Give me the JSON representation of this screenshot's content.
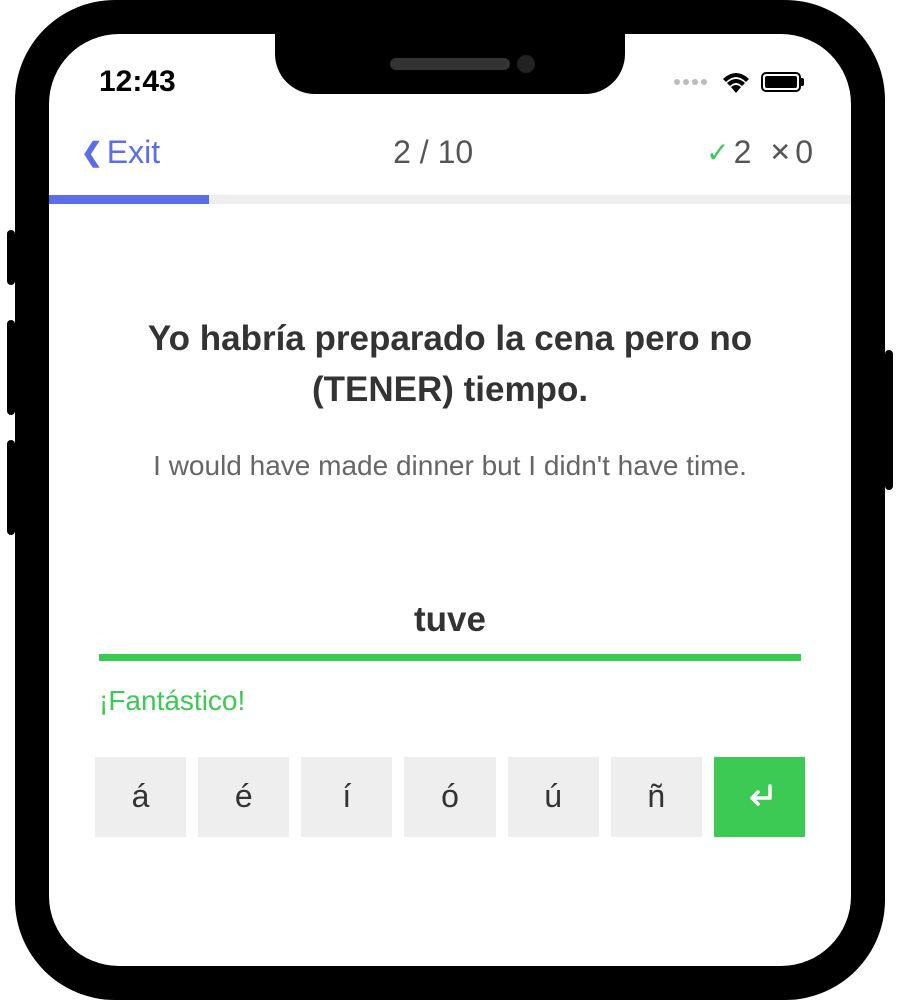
{
  "status": {
    "time": "12:43"
  },
  "nav": {
    "exit_label": "Exit",
    "progress_counter": "2 / 10",
    "correct_count": "2",
    "wrong_count": "0"
  },
  "progress": {
    "percent": 20
  },
  "question": {
    "prompt": "Yo habría preparado la cena pero no (TENER) tiempo.",
    "translation": "I would have made dinner but I didn't have time."
  },
  "answer": {
    "value": "tuve",
    "feedback": "¡Fantástico!"
  },
  "accent_keys": [
    "á",
    "é",
    "í",
    "ó",
    "ú",
    "ñ"
  ],
  "colors": {
    "primary": "#5B6EE8",
    "success": "#3CC954"
  }
}
